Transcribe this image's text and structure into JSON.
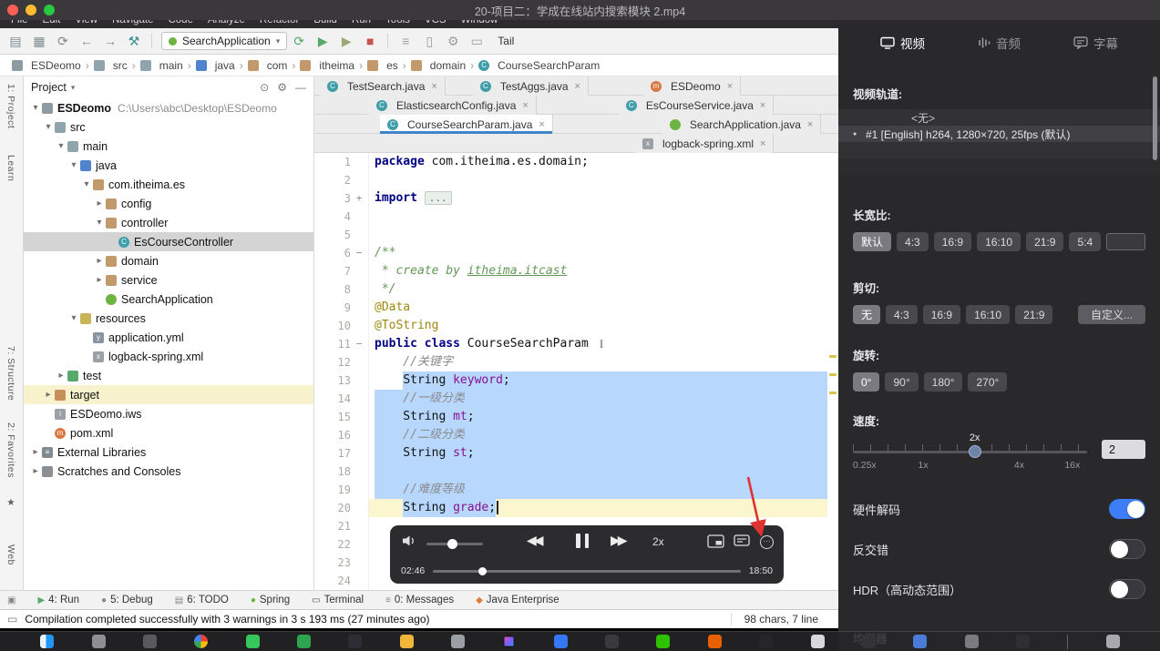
{
  "window": {
    "title": "20-项目二：学成在线站内搜索模块 2.mp4"
  },
  "menubar": {
    "items": [
      "File",
      "Edit",
      "View",
      "Navigate",
      "Code",
      "Analyze",
      "Refactor",
      "Build",
      "Run",
      "Tools",
      "VCS",
      "Window"
    ]
  },
  "toolbar": {
    "run_config": "SearchApplication",
    "tail": "Tail",
    "icons_left": [
      {
        "name": "open-icon",
        "glyph": "▤",
        "color": "#7f8b91"
      },
      {
        "name": "save-icon",
        "glyph": "▦",
        "color": "#7f8b91"
      },
      {
        "name": "sync-icon",
        "glyph": "⟳",
        "color": "#7f8b91"
      },
      {
        "name": "back-icon",
        "glyph": "←",
        "color": "#7f8b91"
      },
      {
        "name": "forward-icon",
        "glyph": "→",
        "color": "#7f8b91"
      },
      {
        "name": "build-icon",
        "glyph": "⚒",
        "color": "#3d8f93"
      }
    ],
    "icons_run": [
      {
        "name": "rerun-icon",
        "glyph": "⟳",
        "color": "#59a869"
      },
      {
        "name": "run-icon",
        "glyph": "▶",
        "color": "#59a869"
      },
      {
        "name": "coverage-icon",
        "glyph": "▶",
        "color": "#9aa87a"
      },
      {
        "name": "stop-icon",
        "glyph": "■",
        "color": "#c75450"
      }
    ],
    "icons_right": [
      {
        "name": "search-icon",
        "glyph": "≡",
        "color": "#9aa0a6"
      },
      {
        "name": "layout-icon",
        "glyph": "▯",
        "color": "#9aa0a6"
      },
      {
        "name": "settings-icon",
        "glyph": "⚙",
        "color": "#9aa0a6"
      },
      {
        "name": "monitor-icon",
        "glyph": "▭",
        "color": "#9aa0a6"
      }
    ]
  },
  "breadcrumbs": {
    "items": [
      {
        "label": "ESDeomo",
        "icon": "module"
      },
      {
        "label": "src",
        "icon": "dir"
      },
      {
        "label": "main",
        "icon": "dir"
      },
      {
        "label": "java",
        "icon": "srcroot"
      },
      {
        "label": "com",
        "icon": "pkg"
      },
      {
        "label": "itheima",
        "icon": "pkg"
      },
      {
        "label": "es",
        "icon": "pkg"
      },
      {
        "label": "domain",
        "icon": "pkg"
      },
      {
        "label": "CourseSearchParam",
        "icon": "class"
      }
    ]
  },
  "tool_stripe": {
    "items": [
      "1: Project",
      "Learn",
      "7: Structure",
      "2: Favorites",
      "★",
      "Web"
    ]
  },
  "project_panel": {
    "title": "Project",
    "tree": [
      {
        "level": 0,
        "arrow": "expanded",
        "icon": "module",
        "label": "ESDeomo",
        "path": "C:\\Users\\abc\\Desktop\\ESDeomo",
        "bold": true
      },
      {
        "level": 1,
        "arrow": "expanded",
        "icon": "dir",
        "label": "src"
      },
      {
        "level": 2,
        "arrow": "expanded",
        "icon": "dir",
        "label": "main"
      },
      {
        "level": 3,
        "arrow": "expanded",
        "icon": "srcroot",
        "label": "java"
      },
      {
        "level": 4,
        "arrow": "expanded",
        "icon": "pkg",
        "label": "com.itheima.es"
      },
      {
        "level": 5,
        "arrow": "collapsed",
        "icon": "pkg",
        "label": "config"
      },
      {
        "level": 5,
        "arrow": "expanded",
        "icon": "pkg",
        "label": "controller"
      },
      {
        "level": 6,
        "arrow": "none",
        "icon": "class",
        "label": "EsCourseController",
        "selected": true
      },
      {
        "level": 5,
        "arrow": "collapsed",
        "icon": "pkg",
        "label": "domain"
      },
      {
        "level": 5,
        "arrow": "collapsed",
        "icon": "pkg",
        "label": "service"
      },
      {
        "level": 5,
        "arrow": "none",
        "icon": "spring",
        "label": "SearchApplication"
      },
      {
        "level": 3,
        "arrow": "expanded",
        "icon": "resources",
        "label": "resources"
      },
      {
        "level": 4,
        "arrow": "none",
        "icon": "yml",
        "label": "application.yml"
      },
      {
        "level": 4,
        "arrow": "none",
        "icon": "xml",
        "label": "logback-spring.xml"
      },
      {
        "level": 2,
        "arrow": "collapsed",
        "icon": "testdir",
        "label": "test"
      },
      {
        "level": 1,
        "arrow": "collapsed",
        "icon": "target",
        "label": "target",
        "highlighted": true
      },
      {
        "level": 1,
        "arrow": "none",
        "icon": "iws",
        "label": "ESDeomo.iws"
      },
      {
        "level": 1,
        "arrow": "none",
        "icon": "maven",
        "label": "pom.xml"
      },
      {
        "level": 0,
        "arrow": "collapsed",
        "icon": "lib",
        "label": "External Libraries"
      },
      {
        "level": 0,
        "arrow": "collapsed",
        "icon": "scratch",
        "label": "Scratches and Consoles"
      }
    ]
  },
  "editor_tabs": {
    "rows": [
      {
        "offset": 6,
        "tabs": [
          {
            "label": "TestSearch.java",
            "icon": "class",
            "close": true
          },
          {
            "label": "TestAggs.java",
            "icon": "class",
            "close": true,
            "gap_before": 30
          },
          {
            "label": "ESDeomo",
            "icon": "maven",
            "close": true,
            "gap_before": 60
          }
        ]
      },
      {
        "offset": 60,
        "tabs": [
          {
            "label": "ElasticsearchConfig.java",
            "icon": "class",
            "close": true
          },
          {
            "label": "EsCourseService.java",
            "icon": "class",
            "close": true,
            "gap_before": 90
          }
        ]
      },
      {
        "offset": 72,
        "tabs": [
          {
            "label": "CourseSearchParam.java",
            "icon": "class",
            "close": true,
            "active": true
          },
          {
            "label": "SearchApplication.java",
            "icon": "spring",
            "close": true,
            "gap_before": 120
          }
        ]
      },
      {
        "offset": 352,
        "tabs": [
          {
            "label": "logback-spring.xml",
            "icon": "xml",
            "close": true
          }
        ]
      }
    ]
  },
  "editor": {
    "lines": [
      {
        "n": 1,
        "tokens": [
          {
            "t": "package ",
            "c": "kw"
          },
          {
            "t": "com.itheima.es.domain;",
            "c": "pl"
          }
        ]
      },
      {
        "n": 2,
        "tokens": []
      },
      {
        "n": 3,
        "fold": "plus",
        "tokens": [
          {
            "t": "import ",
            "c": "kw"
          },
          {
            "t": "...",
            "c": "folded"
          }
        ]
      },
      {
        "n": 4,
        "tokens": []
      },
      {
        "n": 5,
        "tokens": []
      },
      {
        "n": 6,
        "fold": "minus",
        "tokens": [
          {
            "t": "/**",
            "c": "doc"
          }
        ]
      },
      {
        "n": 7,
        "tokens": [
          {
            "t": " * ",
            "c": "doc"
          },
          {
            "t": "create by ",
            "c": "doc"
          },
          {
            "t": "itheima.itcast",
            "c": "doclink"
          }
        ]
      },
      {
        "n": 8,
        "tokens": [
          {
            "t": " */",
            "c": "doc"
          }
        ]
      },
      {
        "n": 9,
        "tokens": [
          {
            "t": "@Data",
            "c": "ann"
          }
        ]
      },
      {
        "n": 10,
        "tokens": [
          {
            "t": "@ToString",
            "c": "ann"
          }
        ]
      },
      {
        "n": 11,
        "fold": "minus",
        "ibeam": true,
        "tokens": [
          {
            "t": "public class ",
            "c": "kw"
          },
          {
            "t": "CourseSearchParam",
            "c": "pl"
          }
        ]
      },
      {
        "n": 12,
        "tokens": [
          {
            "t": "    //关键字",
            "c": "cmt"
          }
        ]
      },
      {
        "n": 13,
        "sel": "full-from-text",
        "tokens": [
          {
            "t": "    ",
            "c": "pl"
          },
          {
            "t": "String ",
            "c": "pl"
          },
          {
            "t": "keyword",
            "c": "field"
          },
          {
            "t": ";",
            "c": "pl"
          }
        ]
      },
      {
        "n": 14,
        "sel": "full",
        "tokens": [
          {
            "t": "    //一级分类",
            "c": "cmt"
          }
        ]
      },
      {
        "n": 15,
        "sel": "full",
        "tokens": [
          {
            "t": "    String ",
            "c": "pl"
          },
          {
            "t": "mt",
            "c": "field"
          },
          {
            "t": ";",
            "c": "pl"
          }
        ]
      },
      {
        "n": 16,
        "sel": "full",
        "tokens": [
          {
            "t": "    //二级分类",
            "c": "cmt"
          }
        ]
      },
      {
        "n": 17,
        "sel": "full",
        "tokens": [
          {
            "t": "    String ",
            "c": "pl"
          },
          {
            "t": "st",
            "c": "field"
          },
          {
            "t": ";",
            "c": "pl"
          }
        ]
      },
      {
        "n": 18,
        "sel": "full",
        "tokens": []
      },
      {
        "n": 19,
        "sel": "full",
        "tokens": [
          {
            "t": "    //难度等级",
            "c": "cmt"
          }
        ]
      },
      {
        "n": 20,
        "sel": "text",
        "current": true,
        "caret": true,
        "tokens": [
          {
            "t": "    ",
            "c": "pl"
          },
          {
            "t": "String ",
            "c": "pl"
          },
          {
            "t": "grade",
            "c": "field"
          },
          {
            "t": ";",
            "c": "pl"
          }
        ]
      },
      {
        "n": 21,
        "tokens": []
      },
      {
        "n": 22,
        "tokens": []
      },
      {
        "n": 23,
        "tokens": []
      },
      {
        "n": 24,
        "tokens": []
      }
    ]
  },
  "status_tools": {
    "items": [
      {
        "label": "4: Run",
        "icon": "run"
      },
      {
        "label": "5: Debug",
        "icon": "debug"
      },
      {
        "label": "6: TODO",
        "icon": "todo"
      },
      {
        "label": "Spring",
        "icon": "spring"
      },
      {
        "label": "Terminal",
        "icon": "terminal"
      },
      {
        "label": "0: Messages",
        "icon": "messages"
      },
      {
        "label": "Java Enterprise",
        "icon": "java"
      }
    ]
  },
  "message_bar": {
    "text": "Compilation completed successfully with 3 warnings in 3 s 193 ms (27 minutes ago)",
    "right": "98 chars, 7 line"
  },
  "player": {
    "speed_label": "2x",
    "time_current": "02:46",
    "time_total": "18:50"
  },
  "panel": {
    "tabs": [
      {
        "label": "视频",
        "icon": "video",
        "active": true
      },
      {
        "label": "音频",
        "icon": "audio"
      },
      {
        "label": "字幕",
        "icon": "subtitle"
      }
    ],
    "video_track": {
      "label": "视频轨道:",
      "rows": [
        {
          "text": "<无>"
        },
        {
          "text": "#1  [English] h264, 1280×720, 25fps (默认)",
          "selected": true,
          "bullet": true
        },
        {
          "text": ""
        },
        {
          "text": ""
        }
      ]
    },
    "aspect": {
      "label": "长宽比:",
      "options": [
        {
          "label": "默认",
          "selected": true
        },
        {
          "label": "4:3"
        },
        {
          "label": "16:9"
        },
        {
          "label": "16:10"
        },
        {
          "label": "21:9"
        },
        {
          "label": "5:4"
        }
      ]
    },
    "crop": {
      "label": "剪切:",
      "options": [
        {
          "label": "无",
          "selected": true
        },
        {
          "label": "4:3"
        },
        {
          "label": "16:9"
        },
        {
          "label": "16:10"
        },
        {
          "label": "21:9"
        },
        {
          "label": "自定义..."
        }
      ]
    },
    "rotation": {
      "label": "旋转:",
      "options": [
        {
          "label": "0°",
          "selected": true
        },
        {
          "label": "90°"
        },
        {
          "label": "180°"
        },
        {
          "label": "270°"
        }
      ]
    },
    "speed": {
      "label": "速度:",
      "value": "2",
      "thumb_label": "2x",
      "thumb_pct": 52,
      "scale_labels": [
        {
          "text": "0.25x",
          "pct": 0
        },
        {
          "text": "1x",
          "pct": 30
        },
        {
          "text": "4x",
          "pct": 71
        },
        {
          "text": "16x",
          "pct": 97
        }
      ]
    },
    "toggles": [
      {
        "name": "hardware-decoding",
        "label": "硬件解码",
        "on": true
      },
      {
        "name": "deinterlace",
        "label": "反交错",
        "on": false
      },
      {
        "name": "hdr",
        "label": "HDR（高动态范围）",
        "on": false
      }
    ],
    "equalizer_label": "均衡器"
  },
  "dock": {
    "items": [
      {
        "name": "finder",
        "color": "finder"
      },
      {
        "name": "launchpad",
        "color": "#8e8e93"
      },
      {
        "name": "screen-app",
        "color": "#5a5a5e"
      },
      {
        "name": "chrome",
        "color": "chrome"
      },
      {
        "name": "app-green-1",
        "color": "#35c759"
      },
      {
        "name": "app-green-2",
        "color": "#2da44e"
      },
      {
        "name": "terminal",
        "color": "#2d2d33"
      },
      {
        "name": "downloads-folder",
        "color": "#f0b63a"
      },
      {
        "name": "app-gray-1",
        "color": "#9aa0a6"
      },
      {
        "name": "intellij-idea",
        "color": "idea"
      },
      {
        "name": "app-blue-1",
        "color": "#3478f6"
      },
      {
        "name": "app-dark-1",
        "color": "#3a3a3e"
      },
      {
        "name": "wechat",
        "color": "#2dc100"
      },
      {
        "name": "firefox",
        "color": "#e66000"
      },
      {
        "name": "app-dark-2",
        "color": "#26262a"
      },
      {
        "name": "textedit",
        "color": "#d8d8dc"
      },
      {
        "name": "app-dark-3",
        "color": "#333338"
      },
      {
        "name": "app-blue-2",
        "color": "#4a7bd8"
      },
      {
        "name": "app-gray-2",
        "color": "#7a7a80"
      },
      {
        "name": "app-dark-4",
        "color": "#2f2f33"
      },
      {
        "name": "separator",
        "separator": true
      },
      {
        "name": "trash",
        "color": "#a8a8ae"
      }
    ]
  }
}
